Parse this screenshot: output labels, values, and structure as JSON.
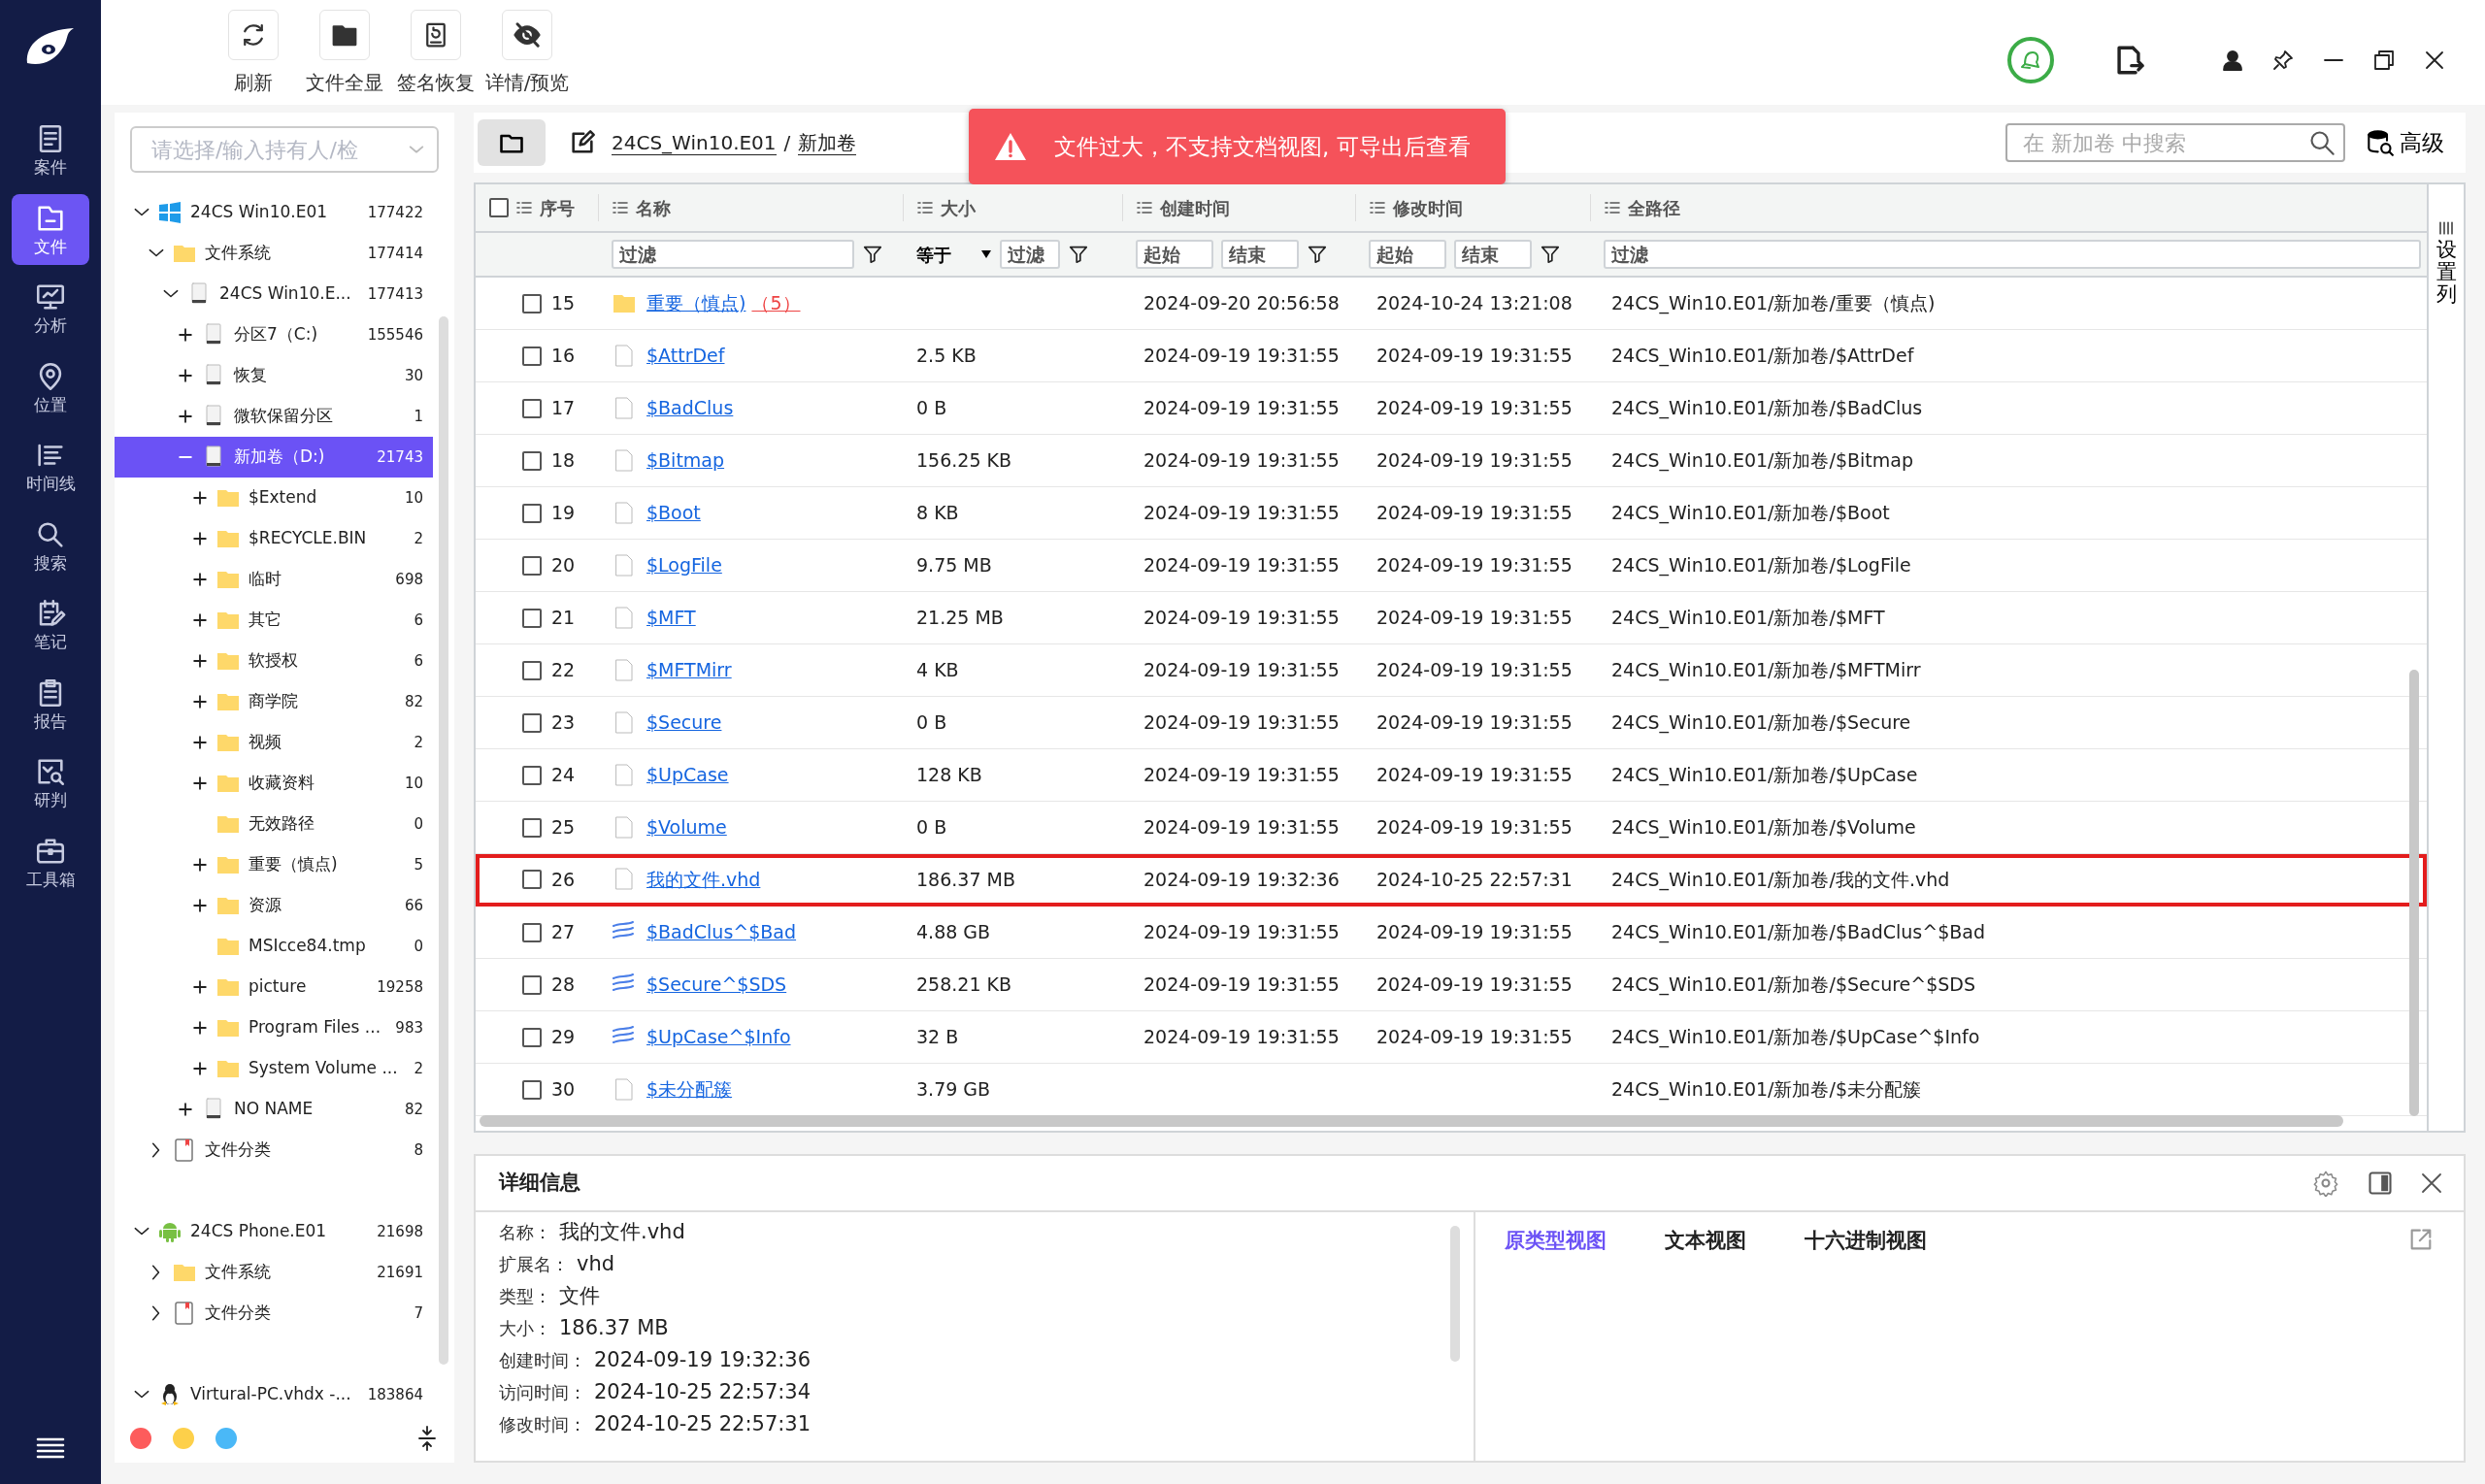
{
  "nav": {
    "items": [
      {
        "label": "案件",
        "selected": false
      },
      {
        "label": "文件",
        "selected": true
      },
      {
        "label": "分析",
        "selected": false
      },
      {
        "label": "位置",
        "selected": false
      },
      {
        "label": "时间线",
        "selected": false
      },
      {
        "label": "搜索",
        "selected": false
      },
      {
        "label": "笔记",
        "selected": false
      },
      {
        "label": "报告",
        "selected": false
      },
      {
        "label": "研判",
        "selected": false
      },
      {
        "label": "工具箱",
        "selected": false
      }
    ]
  },
  "toolbar": {
    "buttons": [
      {
        "label": "刷新"
      },
      {
        "label": "文件全显"
      },
      {
        "label": "签名恢复"
      },
      {
        "label": "详情/预览"
      }
    ]
  },
  "tree": {
    "owner_select": {
      "placeholder": "请选择/输入持有人/检"
    },
    "nodes": [
      {
        "label": "24CS  Win10.E01",
        "count": "177422",
        "kind": "windows",
        "expanded": true,
        "selected": false,
        "children": [
          {
            "label": "文件系统",
            "count": "177414",
            "kind": "folder",
            "expanded": true,
            "selected": false,
            "children": [
              {
                "label": "24CS  Win10.E...",
                "count": "177413",
                "kind": "drive",
                "expanded": true,
                "selected": false,
                "children": [
                  {
                    "label": "分区7（C:)",
                    "count": "155546",
                    "kind": "drive",
                    "expanded": false,
                    "selected": false
                  },
                  {
                    "label": "恢复",
                    "count": "30",
                    "kind": "drive",
                    "expanded": false,
                    "selected": false
                  },
                  {
                    "label": "微软保留分区",
                    "count": "1",
                    "kind": "drive",
                    "expanded": false,
                    "selected": false
                  },
                  {
                    "label": "新加卷（D:)",
                    "count": "21743",
                    "kind": "drive",
                    "expanded": true,
                    "selected": true,
                    "children": [
                      {
                        "label": "$Extend",
                        "count": "10",
                        "kind": "folder",
                        "expanded": false,
                        "selected": false
                      },
                      {
                        "label": "$RECYCLE.BIN",
                        "count": "2",
                        "kind": "folder",
                        "expanded": false,
                        "selected": false
                      },
                      {
                        "label": "临时",
                        "count": "698",
                        "kind": "folder",
                        "expanded": false,
                        "selected": false
                      },
                      {
                        "label": "其它",
                        "count": "6",
                        "kind": "folder",
                        "expanded": false,
                        "selected": false
                      },
                      {
                        "label": "软授权",
                        "count": "6",
                        "kind": "folder",
                        "expanded": false,
                        "selected": false
                      },
                      {
                        "label": "商学院",
                        "count": "82",
                        "kind": "folder",
                        "expanded": false,
                        "selected": false
                      },
                      {
                        "label": "视频",
                        "count": "2",
                        "kind": "folder",
                        "expanded": false,
                        "selected": false
                      },
                      {
                        "label": "收藏资料",
                        "count": "10",
                        "kind": "folder",
                        "expanded": false,
                        "selected": false
                      },
                      {
                        "label": "无效路径",
                        "count": "0",
                        "kind": "folder",
                        "selected": false
                      },
                      {
                        "label": "重要（慎点)",
                        "count": "5",
                        "kind": "folder",
                        "expanded": false,
                        "selected": false
                      },
                      {
                        "label": "资源",
                        "count": "66",
                        "kind": "folder",
                        "expanded": false,
                        "selected": false
                      },
                      {
                        "label": "MSIcce84.tmp",
                        "count": "0",
                        "kind": "folder",
                        "selected": false
                      },
                      {
                        "label": "picture",
                        "count": "19258",
                        "kind": "folder",
                        "expanded": false,
                        "selected": false
                      },
                      {
                        "label": "Program Files ...",
                        "count": "983",
                        "kind": "folder",
                        "expanded": false,
                        "selected": false
                      },
                      {
                        "label": "System Volume ...",
                        "count": "2",
                        "kind": "folder",
                        "expanded": false,
                        "selected": false
                      }
                    ]
                  },
                  {
                    "label": "NO NAME",
                    "count": "82",
                    "kind": "drive",
                    "expanded": false,
                    "selected": false
                  }
                ]
              }
            ]
          },
          {
            "label": "文件分类",
            "count": "8",
            "kind": "category",
            "expanded": false,
            "selected": false
          }
        ]
      },
      {
        "label": "24CS  Phone.E01",
        "count": "21698",
        "kind": "android",
        "expanded": true,
        "selected": false,
        "children": [
          {
            "label": "文件系统",
            "count": "21691",
            "kind": "folder",
            "expanded": false,
            "selected": false
          },
          {
            "label": "文件分类",
            "count": "7",
            "kind": "category",
            "expanded": false,
            "selected": false
          }
        ]
      },
      {
        "label": "Virtural-PC.vhdx -...",
        "count": "183864",
        "kind": "linux",
        "expanded": true,
        "selected": false
      }
    ],
    "color_tags": [
      {
        "color": "#fd5c5c"
      },
      {
        "color": "#fdd04a"
      },
      {
        "color": "#4ab8f7"
      }
    ]
  },
  "breadcrumb": {
    "items": [
      "24CS_Win10.E01",
      "新加卷"
    ],
    "separator": "/"
  },
  "alert": {
    "text": "文件过大，不支持文档视图, 可导出后查看"
  },
  "search": {
    "placeholder": "在 新加卷 中搜索",
    "advanced_label": "高级"
  },
  "table": {
    "columns": [
      "序号",
      "名称",
      "大小",
      "创建时间",
      "修改时间",
      "全路径"
    ],
    "select_all": {
      "checked": false
    },
    "filters": {
      "name": {
        "placeholder": "过滤"
      },
      "size_op": "等于",
      "size": {
        "placeholder": "过滤"
      },
      "created_from": {
        "placeholder": "起始"
      },
      "created_to": {
        "placeholder": "结束"
      },
      "modified_from": {
        "placeholder": "起始"
      },
      "modified_to": {
        "placeholder": "结束"
      },
      "path": {
        "placeholder": "过滤"
      }
    },
    "column_settings": "设置列",
    "rows": [
      {
        "index": "15",
        "kind": "folder",
        "name": "重要（慎点)",
        "count": "（5）",
        "size": "",
        "created": "2024-09-20 20:56:58",
        "modified": "2024-10-24 13:21:08",
        "path": "24CS_Win10.E01/新加卷/重要（慎点)",
        "checked": false,
        "selected": false
      },
      {
        "index": "16",
        "kind": "file",
        "name": "$AttrDef",
        "size": "2.5 KB",
        "created": "2024-09-19 19:31:55",
        "modified": "2024-09-19 19:31:55",
        "path": "24CS_Win10.E01/新加卷/$AttrDef",
        "checked": false,
        "selected": false
      },
      {
        "index": "17",
        "kind": "file",
        "name": "$BadClus",
        "size": "0 B",
        "created": "2024-09-19 19:31:55",
        "modified": "2024-09-19 19:31:55",
        "path": "24CS_Win10.E01/新加卷/$BadClus",
        "checked": false,
        "selected": false
      },
      {
        "index": "18",
        "kind": "file",
        "name": "$Bitmap",
        "size": "156.25 KB",
        "created": "2024-09-19 19:31:55",
        "modified": "2024-09-19 19:31:55",
        "path": "24CS_Win10.E01/新加卷/$Bitmap",
        "checked": false,
        "selected": false
      },
      {
        "index": "19",
        "kind": "file",
        "name": "$Boot",
        "size": "8 KB",
        "created": "2024-09-19 19:31:55",
        "modified": "2024-09-19 19:31:55",
        "path": "24CS_Win10.E01/新加卷/$Boot",
        "checked": false,
        "selected": false
      },
      {
        "index": "20",
        "kind": "file",
        "name": "$LogFile",
        "size": "9.75 MB",
        "created": "2024-09-19 19:31:55",
        "modified": "2024-09-19 19:31:55",
        "path": "24CS_Win10.E01/新加卷/$LogFile",
        "checked": false,
        "selected": false
      },
      {
        "index": "21",
        "kind": "file",
        "name": "$MFT",
        "size": "21.25 MB",
        "created": "2024-09-19 19:31:55",
        "modified": "2024-09-19 19:31:55",
        "path": "24CS_Win10.E01/新加卷/$MFT",
        "checked": false,
        "selected": false
      },
      {
        "index": "22",
        "kind": "file",
        "name": "$MFTMirr",
        "size": "4 KB",
        "created": "2024-09-19 19:31:55",
        "modified": "2024-09-19 19:31:55",
        "path": "24CS_Win10.E01/新加卷/$MFTMirr",
        "checked": false,
        "selected": false
      },
      {
        "index": "23",
        "kind": "file",
        "name": "$Secure",
        "size": "0 B",
        "created": "2024-09-19 19:31:55",
        "modified": "2024-09-19 19:31:55",
        "path": "24CS_Win10.E01/新加卷/$Secure",
        "checked": false,
        "selected": false
      },
      {
        "index": "24",
        "kind": "file",
        "name": "$UpCase",
        "size": "128 KB",
        "created": "2024-09-19 19:31:55",
        "modified": "2024-09-19 19:31:55",
        "path": "24CS_Win10.E01/新加卷/$UpCase",
        "checked": false,
        "selected": false
      },
      {
        "index": "25",
        "kind": "file",
        "name": "$Volume",
        "size": "0 B",
        "created": "2024-09-19 19:31:55",
        "modified": "2024-09-19 19:31:55",
        "path": "24CS_Win10.E01/新加卷/$Volume",
        "checked": false,
        "selected": false
      },
      {
        "index": "26",
        "kind": "file",
        "name": "我的文件.vhd",
        "size": "186.37 MB",
        "created": "2024-09-19 19:32:36",
        "modified": "2024-10-25 22:57:31",
        "path": "24CS_Win10.E01/新加卷/我的文件.vhd",
        "checked": false,
        "selected": true
      },
      {
        "index": "27",
        "kind": "stream",
        "name": "$BadClus^$Bad",
        "size": "4.88 GB",
        "created": "2024-09-19 19:31:55",
        "modified": "2024-09-19 19:31:55",
        "path": "24CS_Win10.E01/新加卷/$BadClus^$Bad",
        "checked": false,
        "selected": false
      },
      {
        "index": "28",
        "kind": "stream",
        "name": "$Secure^$SDS",
        "size": "258.21 KB",
        "created": "2024-09-19 19:31:55",
        "modified": "2024-09-19 19:31:55",
        "path": "24CS_Win10.E01/新加卷/$Secure^$SDS",
        "checked": false,
        "selected": false
      },
      {
        "index": "29",
        "kind": "stream",
        "name": "$UpCase^$Info",
        "size": "32 B",
        "created": "2024-09-19 19:31:55",
        "modified": "2024-09-19 19:31:55",
        "path": "24CS_Win10.E01/新加卷/$UpCase^$Info",
        "checked": false,
        "selected": false
      },
      {
        "index": "30",
        "kind": "file",
        "name": "$未分配簇",
        "size": "3.79 GB",
        "created": "",
        "modified": "",
        "path": "24CS_Win10.E01/新加卷/$未分配簇",
        "checked": false,
        "selected": false
      }
    ]
  },
  "details": {
    "title": "详细信息",
    "fields": [
      {
        "label": "名称：",
        "value": "我的文件.vhd"
      },
      {
        "label": "扩展名：",
        "value": "vhd"
      },
      {
        "label": "类型：",
        "value": "文件"
      },
      {
        "label": "大小：",
        "value": "186.37 MB"
      },
      {
        "label": "创建时间：",
        "value": "2024-09-19 19:32:36"
      },
      {
        "label": "访问时间：",
        "value": "2024-10-25 22:57:34"
      },
      {
        "label": "修改时间：",
        "value": "2024-10-25 22:57:31"
      }
    ],
    "tabs": [
      {
        "label": "原类型视图",
        "selected": true
      },
      {
        "label": "文本视图",
        "selected": false
      },
      {
        "label": "十六进制视图",
        "selected": false
      }
    ]
  }
}
